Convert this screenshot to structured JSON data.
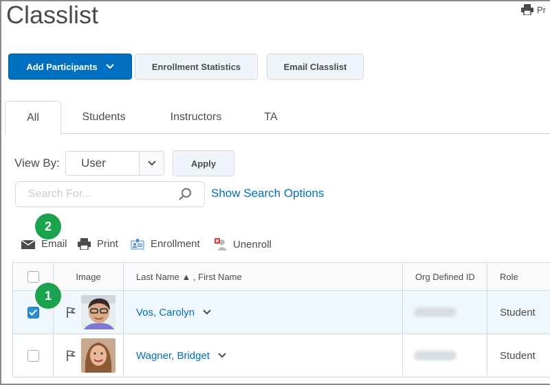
{
  "page": {
    "title": "Classlist",
    "print_label": "Pr"
  },
  "toolbar": {
    "add_participants": "Add Participants",
    "enrollment_statistics": "Enrollment Statistics",
    "email_classlist": "Email Classlist"
  },
  "tabs": [
    {
      "label": "All",
      "active": true
    },
    {
      "label": "Students",
      "active": false
    },
    {
      "label": "Instructors",
      "active": false
    },
    {
      "label": "TA",
      "active": false
    }
  ],
  "filters": {
    "view_by_label": "View By:",
    "view_by_value": "User",
    "apply_label": "Apply",
    "search_placeholder": "Search For...",
    "search_options_label": "Show Search Options"
  },
  "actions": {
    "email": "Email",
    "print": "Print",
    "enrollment": "Enrollment",
    "unenroll": "Unenroll"
  },
  "callouts": {
    "one": "1",
    "two": "2"
  },
  "table": {
    "headers": {
      "image": "Image",
      "name": "Last Name ▲ , First Name",
      "org_id": "Org Defined ID",
      "role": "Role"
    },
    "rows": [
      {
        "name": "Vos, Carolyn",
        "role": "Student",
        "checked": true
      },
      {
        "name": "Wagner, Bridget",
        "role": "Student",
        "checked": false
      }
    ]
  },
  "colors": {
    "primary": "#006fbf",
    "callout": "#1aa24e",
    "text": "#494c4e"
  },
  "icons": [
    "printer-icon",
    "chevron-down-icon",
    "search-icon",
    "envelope-icon",
    "enrollment-icon",
    "unenroll-icon",
    "flag-icon",
    "checkmark-icon"
  ]
}
